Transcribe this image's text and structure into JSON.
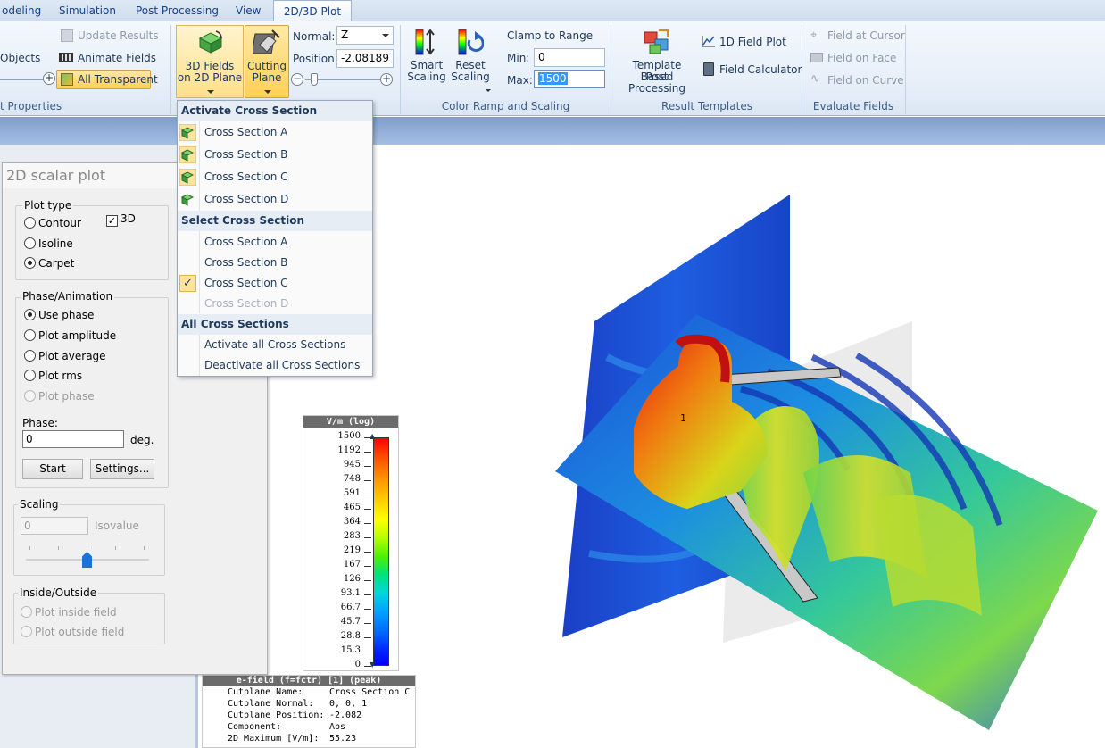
{
  "tabs": [
    "odeling",
    "Simulation",
    "Post Processing",
    "View",
    "2D/3D Plot"
  ],
  "ribbon": {
    "objects_label": "Objects",
    "properties_label": "t Properties",
    "update_results": "Update Results",
    "animate_fields": "Animate Fields",
    "all_transparent": "All Transparent",
    "fields_3d_line1": "3D Fields",
    "fields_3d_line2": "on 2D Plane",
    "cutting_line1": "Cutting",
    "cutting_line2": "Plane",
    "normal_label": "Normal:",
    "normal_value": "Z",
    "position_label": "Position:",
    "position_value": "-2.08189",
    "smart_line1": "Smart",
    "smart_line2": "Scaling",
    "reset_line1": "Reset",
    "reset_line2": "Scaling",
    "clamp_label": "Clamp to Range",
    "min_label": "Min:",
    "min_value": "0",
    "max_label": "Max:",
    "max_value": "1500",
    "color_ramp_group": "Color Ramp and Scaling",
    "template_line1": "Template Based",
    "template_line2": "Post Processing",
    "field_plot_1d": "1D Field Plot",
    "field_calculator": "Field Calculator",
    "result_templates_group": "Result Templates",
    "field_at_cursor": "Field at Cursor",
    "field_on_face": "Field on Face",
    "field_on_curve": "Field on Curve",
    "evaluate_fields_group": "Evaluate Fields"
  },
  "dialog": {
    "title": "2D scalar plot",
    "plot_type_title": "Plot type",
    "contour": "Contour",
    "isoline": "Isoline",
    "carpet": "Carpet",
    "three_d": "3D",
    "phase_anim_title": "Phase/Animation",
    "use_phase": "Use phase",
    "plot_amplitude": "Plot amplitude",
    "plot_average": "Plot average",
    "plot_rms": "Plot rms",
    "plot_phase": "Plot phase",
    "phase_label": "Phase:",
    "phase_value": "0",
    "phase_unit": "deg.",
    "start_btn": "Start",
    "settings_btn": "Settings...",
    "scaling_title": "Scaling",
    "scaling_value": "0",
    "isovalue": "Isovalue",
    "inside_outside_title": "Inside/Outside",
    "plot_inside": "Plot inside field",
    "plot_outside": "Plot outside field"
  },
  "menu": {
    "activate_head": "Activate Cross Section",
    "activate_items": [
      "Cross Section A",
      "Cross Section B",
      "Cross Section C",
      "Cross Section D"
    ],
    "select_head": "Select Cross Section",
    "select_items": [
      "Cross Section A",
      "Cross Section B",
      "Cross Section C",
      "Cross Section D"
    ],
    "all_head": "All Cross Sections",
    "all_items": [
      "Activate all Cross Sections",
      "Deactivate all Cross Sections"
    ]
  },
  "legend": {
    "title": "V/m (log)",
    "labels": [
      "1500",
      "1192",
      "945",
      "748",
      "591",
      "465",
      "364",
      "283",
      "219",
      "167",
      "126",
      "93.1",
      "66.7",
      "45.7",
      "28.8",
      "15.3",
      "0"
    ]
  },
  "info": {
    "title": "e-field (f=fctr) [1] (peak)",
    "rows": [
      {
        "k": "Cutplane Name:",
        "v": "Cross Section C"
      },
      {
        "k": "Cutplane Normal:",
        "v": "0, 0, 1"
      },
      {
        "k": "Cutplane Position:",
        "v": "-2.082"
      },
      {
        "k": "Component:",
        "v": "Abs"
      },
      {
        "k": "2D Maximum [V/m]:",
        "v": "55.23"
      }
    ]
  },
  "scene": {
    "port_label": "1"
  }
}
